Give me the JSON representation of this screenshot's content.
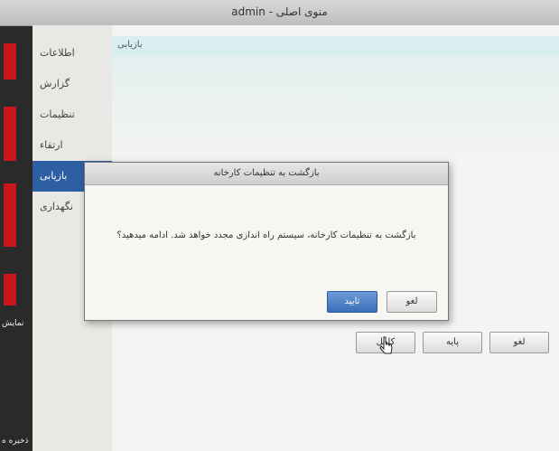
{
  "window": {
    "title": "منوی اصلی - admin"
  },
  "sidebar": {
    "items": [
      {
        "label": "اطلاعات"
      },
      {
        "label": "گزارش"
      },
      {
        "label": "تنظیمات"
      },
      {
        "label": "ارتقاء"
      },
      {
        "label": "بازیابی",
        "active": true
      },
      {
        "label": "نگهداری"
      }
    ]
  },
  "content": {
    "header": "بازیابی"
  },
  "buttons": {
    "full": "کامل",
    "basic": "پایه",
    "cancel": "لغو"
  },
  "dialog": {
    "title": "بازگشت به تنظیمات کارخانه",
    "message": "بازگشت به تنظیمات کارخانه، سیستم راه اندازی مجدد خواهد شد. ادامه میدهید؟",
    "confirm": "تایید",
    "cancel": "لغو"
  },
  "background": {
    "label1": "نمایش",
    "label2": "ذخیره ه"
  },
  "colors": {
    "accent": "#2f5fa3",
    "primary_button": "#3a6fb8",
    "background_red": "#c8161b"
  }
}
